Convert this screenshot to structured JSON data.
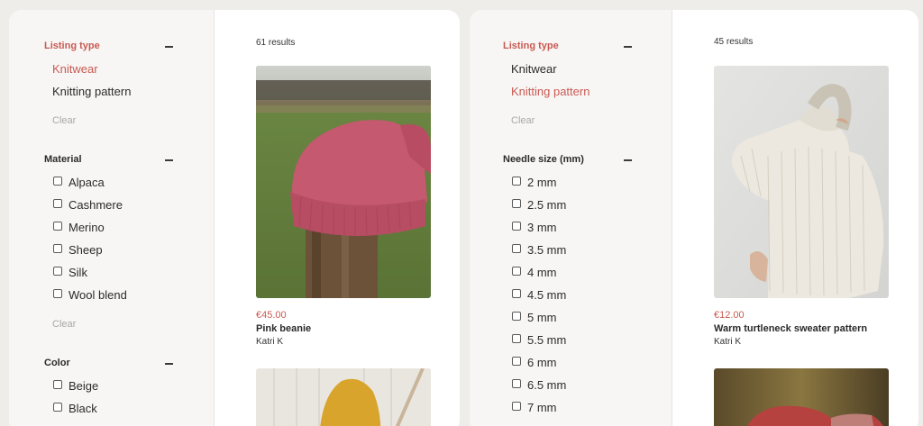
{
  "left": {
    "listing_type": {
      "heading": "Listing type",
      "options": [
        {
          "label": "Knitwear",
          "active": true
        },
        {
          "label": "Knitting pattern",
          "active": false
        }
      ],
      "clear": "Clear"
    },
    "material": {
      "heading": "Material",
      "options": [
        "Alpaca",
        "Cashmere",
        "Merino",
        "Sheep",
        "Silk",
        "Wool blend"
      ],
      "clear": "Clear"
    },
    "color": {
      "heading": "Color",
      "options": [
        "Beige",
        "Black"
      ]
    },
    "results": "61 results",
    "product": {
      "price": "€45.00",
      "title": "Pink beanie",
      "author": "Katri K"
    }
  },
  "right": {
    "listing_type": {
      "heading": "Listing type",
      "options": [
        {
          "label": "Knitwear",
          "active": false
        },
        {
          "label": "Knitting pattern",
          "active": true
        }
      ],
      "clear": "Clear"
    },
    "needle_size": {
      "heading": "Needle size (mm)",
      "options": [
        "2 mm",
        "2.5 mm",
        "3 mm",
        "3.5 mm",
        "4 mm",
        "4.5 mm",
        "5 mm",
        "5.5 mm",
        "6 mm",
        "6.5 mm",
        "7 mm"
      ]
    },
    "results": "45 results",
    "product": {
      "price": "€12.00",
      "title": "Warm turtleneck sweater pattern",
      "author": "Katri K"
    }
  },
  "colors": {
    "accent": "#c95a52",
    "panel": "#ffffff",
    "sidebar": "#f7f6f4",
    "background": "#eeede9"
  }
}
